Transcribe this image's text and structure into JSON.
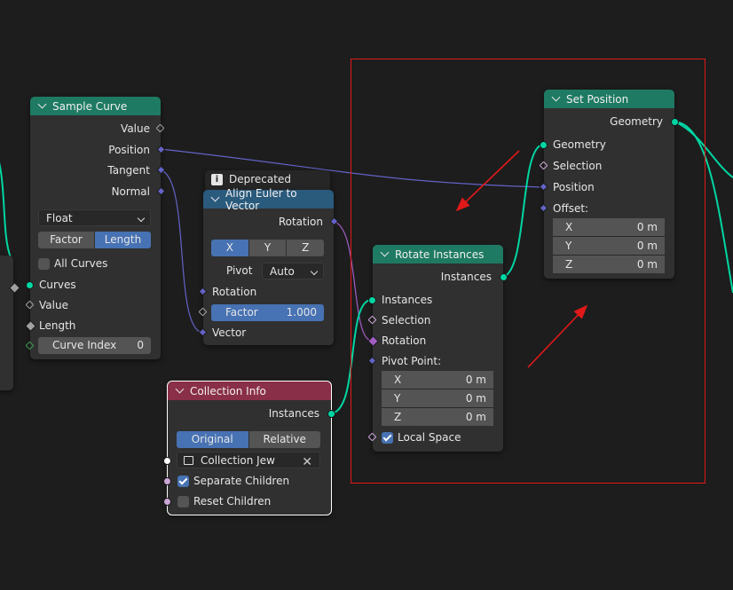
{
  "sample_curve": {
    "title": "Sample Curve",
    "outputs": [
      "Value",
      "Position",
      "Tangent",
      "Normal"
    ],
    "mode": "Float",
    "modes": [
      "Factor",
      "Length"
    ],
    "all_curves": "All Curves",
    "inputs": [
      "Curves",
      "Value",
      "Length"
    ],
    "curve_index_label": "Curve Index",
    "curve_index_value": "0"
  },
  "deprecated": {
    "label": "Deprecated",
    "icon": "info-icon"
  },
  "align_euler": {
    "title": "Align Euler to Vector",
    "output": "Rotation",
    "axes": [
      "X",
      "Y",
      "Z"
    ],
    "pivot_label": "Pivot",
    "pivot_value": "Auto",
    "input_rotation": "Rotation",
    "factor_label": "Factor",
    "factor_value": "1.000",
    "input_vector": "Vector"
  },
  "collection_info": {
    "title": "Collection Info",
    "output": "Instances",
    "modes": [
      "Original",
      "Relative"
    ],
    "collection_name": "Collection Jew",
    "separate_children": "Separate Children",
    "reset_children": "Reset Children"
  },
  "rotate_instances": {
    "title": "Rotate Instances",
    "output": "Instances",
    "inputs": [
      "Instances",
      "Selection",
      "Rotation"
    ],
    "pivot_label": "Pivot Point:",
    "pivot": [
      {
        "axis": "X",
        "value": "0 m"
      },
      {
        "axis": "Y",
        "value": "0 m"
      },
      {
        "axis": "Z",
        "value": "0 m"
      }
    ],
    "local_space": "Local Space"
  },
  "set_position": {
    "title": "Set Position",
    "output": "Geometry",
    "inputs": [
      "Geometry",
      "Selection",
      "Position"
    ],
    "offset_label": "Offset:",
    "offset": [
      {
        "axis": "X",
        "value": "0 m"
      },
      {
        "axis": "Y",
        "value": "0 m"
      },
      {
        "axis": "Z",
        "value": "0 m"
      }
    ]
  },
  "colors": {
    "geometry": "#00d6a3",
    "vector": "#6363c7",
    "annotation": "#e01919",
    "header_geometry": "#1e7a62",
    "header_vector": "#2a5a7c",
    "header_input": "#8a2f48"
  }
}
